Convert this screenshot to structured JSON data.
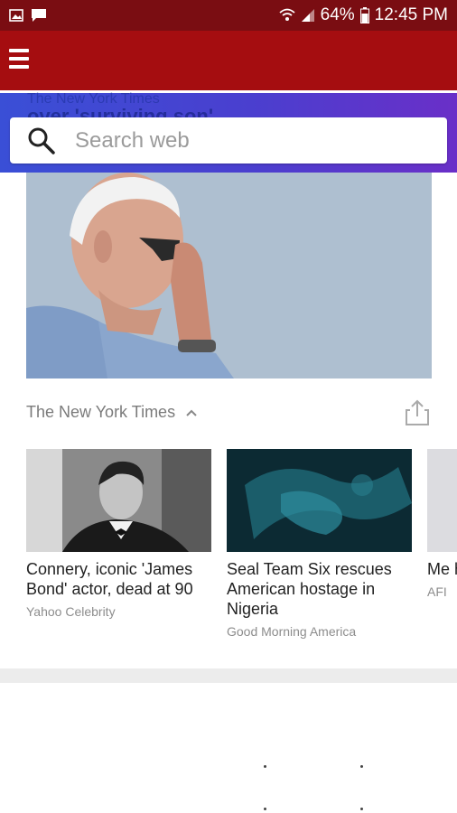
{
  "status_bar": {
    "battery": "64%",
    "time": "12:45 PM"
  },
  "search": {
    "placeholder": "Search web"
  },
  "behind_header": {
    "source": "The New York Times",
    "title": "over 'surviving son'"
  },
  "hero_story": {
    "source": "The New York Times"
  },
  "cards": [
    {
      "title": "Connery, iconic 'James Bond' actor, dead at 90",
      "source": "Yahoo Celebrity"
    },
    {
      "title": "Seal Team Six rescues American hostage in Nigeria",
      "source": "Good Morning America"
    },
    {
      "title": "Me ho far",
      "source": "AFI"
    }
  ],
  "colors": {
    "status_bar": "#7a0d12",
    "app_bar": "#a50d10",
    "search_band_start": "#3a4fd6",
    "search_band_end": "#6a2fc8"
  },
  "icons": [
    "gallery-icon",
    "message-icon",
    "wifi-icon",
    "signal-icon",
    "battery-icon",
    "menu-icon",
    "search-icon",
    "chevron-up-icon",
    "share-icon"
  ]
}
